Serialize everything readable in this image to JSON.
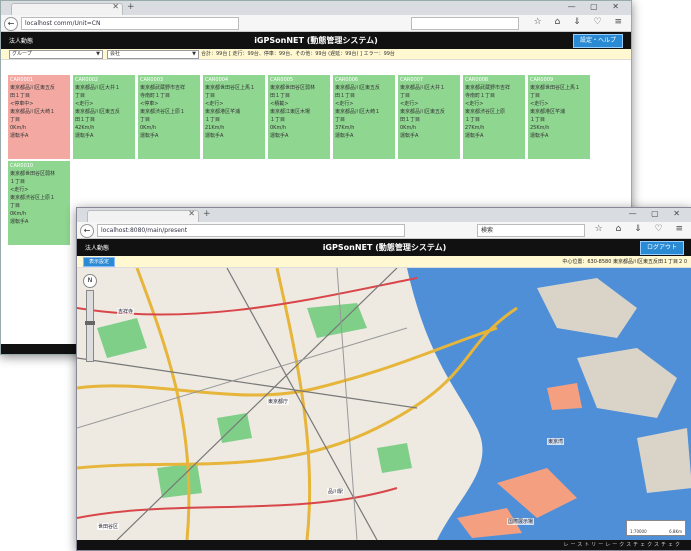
{
  "back_window": {
    "url": "localhost                 comm/Unit=CN",
    "app": {
      "user": "法人動態",
      "title": "iGPSonNET (動態管理システム)",
      "button": "設定・ヘルプ"
    },
    "filters": {
      "group": "グループ",
      "company": "会社",
      "summary": "合計：99台 [ 走行：99台、停車：99台、その他：99台 (遅延：99台) ] エラー：99台"
    },
    "cards": [
      {
        "id": "CAR0001",
        "l1": "東京都品川区東五反",
        "l2": "田１丁目",
        "l3": "<停車中>",
        "l4": "東京都品川区大崎１",
        "l5": "丁目",
        "l6": "0Km/h",
        "l7": "運転手A",
        "color": "red"
      },
      {
        "id": "CAR0002",
        "l1": "東京都品川区大井１",
        "l2": "丁目",
        "l3": "<走行>",
        "l4": "東京都品川区東五反",
        "l5": "田１丁目",
        "l6": "42Km/h",
        "l7": "運転手A",
        "color": "green"
      },
      {
        "id": "CAR0003",
        "l1": "東京都武蔵野市吉祥",
        "l2": "寺南町１丁目",
        "l3": "<停車>",
        "l4": "東京都渋谷区上原１",
        "l5": "丁目",
        "l6": "0Km/h",
        "l7": "運転手A",
        "color": "green"
      },
      {
        "id": "CAR0004",
        "l1": "東京都世田谷区上馬１",
        "l2": "丁目",
        "l3": "<走行>",
        "l4": "東京都港区芊浦",
        "l5": "１丁目",
        "l6": "21Km/h",
        "l7": "運転手A",
        "color": "green"
      },
      {
        "id": "CAR0005",
        "l1": "東京都世田谷区弱林",
        "l2": "田１丁目",
        "l3": "<積載>",
        "l4": "東京都江東区木場",
        "l5": "１丁目",
        "l6": "0Km/h",
        "l7": "運転手A",
        "color": "green"
      },
      {
        "id": "CAR0006",
        "l1": "東京都品川区東五反",
        "l2": "田１丁目",
        "l3": "<走行>",
        "l4": "東京都品川区大崎１",
        "l5": "丁目",
        "l6": "37Km/h",
        "l7": "運転手A",
        "color": "green"
      },
      {
        "id": "CAR0007",
        "l1": "東京都品川区大井１",
        "l2": "丁目",
        "l3": "<走行>",
        "l4": "東京都品川区東五反",
        "l5": "田１丁目",
        "l6": "0Km/h",
        "l7": "運転手A",
        "color": "green"
      },
      {
        "id": "CAR0008",
        "l1": "東京都武蔵野市吉祥",
        "l2": "寺南町１丁目",
        "l3": "<走行>",
        "l4": "東京都渋谷区上原",
        "l5": "１丁目",
        "l6": "27Km/h",
        "l7": "運転手A",
        "color": "green"
      },
      {
        "id": "CAR0009",
        "l1": "東京都世田谷区上馬１",
        "l2": "丁目",
        "l3": "<走行>",
        "l4": "東京都港区芊浦",
        "l5": "１丁目",
        "l6": "25Km/h",
        "l7": "運転手A",
        "color": "green"
      },
      {
        "id": "CAR0010",
        "l1": "東京都世田谷区弱林",
        "l2": "１丁目",
        "l3": "<走行>",
        "l4": "東京都渋谷区上原１",
        "l5": "丁目",
        "l6": "0Km/h",
        "l7": "運転手A",
        "color": "green"
      }
    ]
  },
  "front_window": {
    "url": "localhost:8080/main/present",
    "search_placeholder": "検索",
    "app": {
      "user": "法人動態",
      "title": "iGPSonNET (動態管理システム)",
      "button": "ログアウト"
    },
    "map_setting": "表示設定",
    "center_location": "中心位置：630-8580 東京都品川区東五反田１丁目２０",
    "map_labels": [
      "東京都庁",
      "品川駅",
      "東京湾",
      "国際展示場",
      "吉祥寺",
      "世田谷区"
    ],
    "scale": {
      "left": "1:70000",
      "right": "6.8Km"
    },
    "footer": "レーストリーレークスチェクスチェク"
  }
}
